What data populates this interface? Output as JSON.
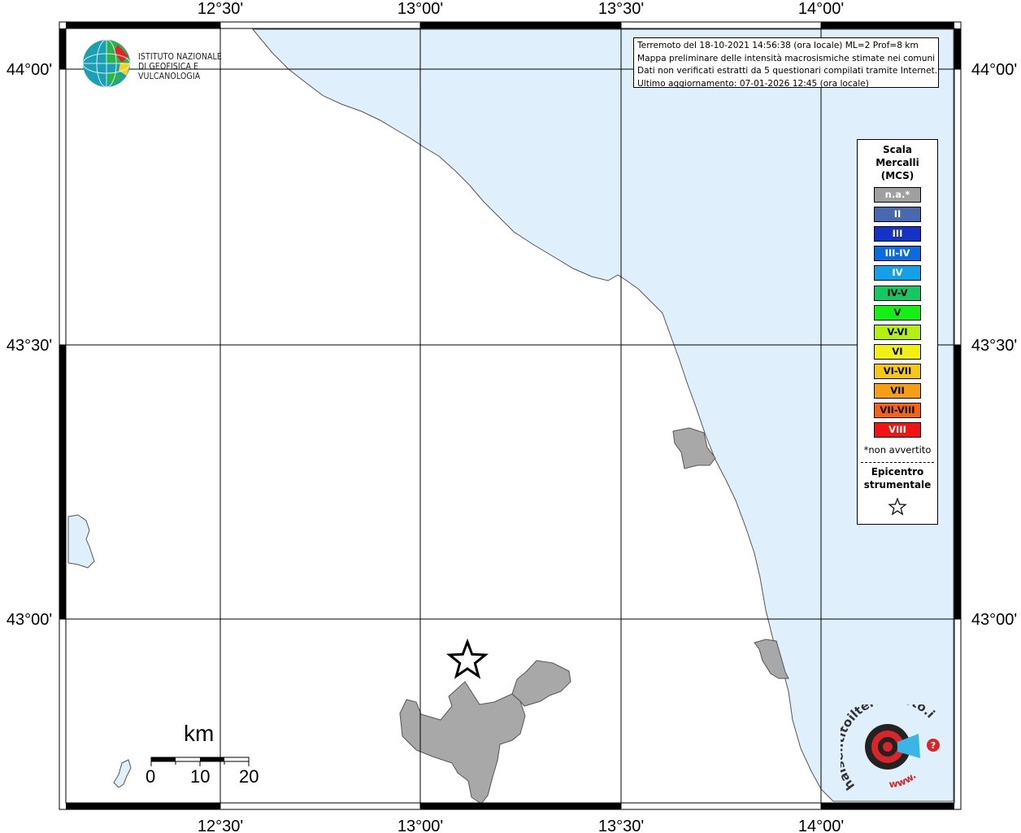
{
  "map_frame": {
    "longitude_ticks_top": [
      "12°30'",
      "13°00'",
      "13°30'",
      "14°00'"
    ],
    "longitude_ticks_bottom": [
      "12°30'",
      "13°00'",
      "13°30'",
      "14°00'"
    ],
    "latitude_ticks_left": [
      "44°00'",
      "43°30'",
      "43°00'"
    ],
    "latitude_ticks_right": [
      "44°00'",
      "43°30'",
      "43°00'"
    ]
  },
  "info": {
    "line1": "Terremoto del 18-10-2021 14:56:38 (ora locale) ML=2 Prof=8 km",
    "line2": "Mappa preliminare delle intensità macrosismiche stimate nei comuni",
    "line3": "Dati non verificati estratti da 5 questionari compilati tramite Internet.",
    "line4": "Ultimo aggiornamento: 07-01-2026 12:45 (ora locale)"
  },
  "logo": {
    "line1": "ISTITUTO NAZIONALE",
    "line2": "DI GEOFISICA E VULCANOLOGIA"
  },
  "legend": {
    "title1": "Scala",
    "title2": "Mercalli",
    "title3": "(MCS)",
    "classes": [
      {
        "label": "n.a.*",
        "color": "#a0a0a0",
        "text_color": "#ffffff"
      },
      {
        "label": "II",
        "color": "#4a68b0",
        "text_color": "#ffffff"
      },
      {
        "label": "III",
        "color": "#1432c8",
        "text_color": "#ffffff"
      },
      {
        "label": "III-IV",
        "color": "#0a6ce0",
        "text_color": "#ffffff"
      },
      {
        "label": "IV",
        "color": "#14a0e6",
        "text_color": "#ffffff"
      },
      {
        "label": "IV-V",
        "color": "#14c864",
        "text_color": "#000000"
      },
      {
        "label": "V",
        "color": "#14f014",
        "text_color": "#000000"
      },
      {
        "label": "V-VI",
        "color": "#b4f014",
        "text_color": "#000000"
      },
      {
        "label": "VI",
        "color": "#f0f014",
        "text_color": "#000000"
      },
      {
        "label": "VI-VII",
        "color": "#f5c814",
        "text_color": "#000000"
      },
      {
        "label": "VII",
        "color": "#f5a014",
        "text_color": "#000000"
      },
      {
        "label": "VII-VIII",
        "color": "#f56414",
        "text_color": "#000000"
      },
      {
        "label": "VIII",
        "color": "#f01414",
        "text_color": "#ffffff"
      }
    ],
    "note": "*non avvertito",
    "epicenter1": "Epicentro",
    "epicenter2": "strumentale"
  },
  "scale_bar": {
    "unit": "km",
    "labels": [
      "0",
      "10",
      "20"
    ]
  },
  "hsi_logo": {
    "text": "haisentitoilterremoto.it",
    "prefix": "www."
  },
  "colors": {
    "sea": "#dff0fc",
    "municipality_na": "#a8a8a8",
    "grid": "#000000"
  }
}
